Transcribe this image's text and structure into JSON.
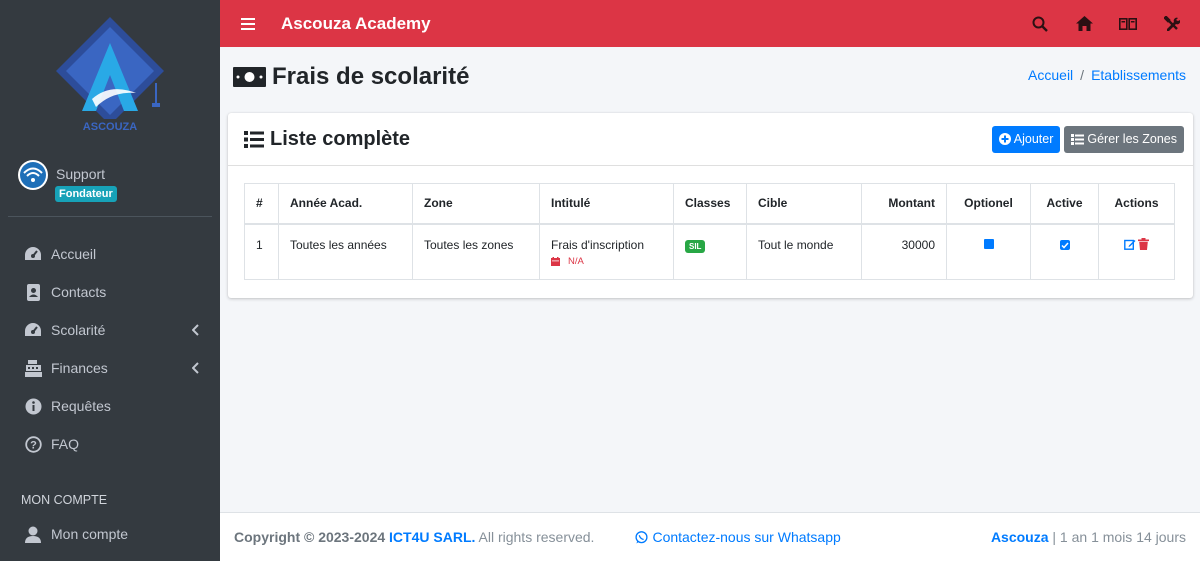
{
  "app": {
    "brand": "Ascouza Academy",
    "logo_text": "ASCOUZA"
  },
  "user": {
    "name": "Support",
    "role": "Fondateur"
  },
  "sidebar": {
    "items": [
      {
        "label": "Accueil",
        "icon": "dashboard-icon"
      },
      {
        "label": "Contacts",
        "icon": "address-book-icon"
      },
      {
        "label": "Scolarité",
        "icon": "dashboard-icon",
        "has_children": true
      },
      {
        "label": "Finances",
        "icon": "cash-register-icon",
        "has_children": true
      },
      {
        "label": "Requêtes",
        "icon": "info-circle-icon"
      },
      {
        "label": "FAQ",
        "icon": "question-circle-icon"
      }
    ],
    "section_header": "MON COMPTE",
    "account_item": {
      "label": "Mon compte",
      "icon": "user-icon"
    }
  },
  "page": {
    "title": "Frais de scolarité",
    "breadcrumb": [
      "Accueil",
      "Etablissements"
    ]
  },
  "card": {
    "title": "Liste complète",
    "add_button": "Ajouter",
    "zones_button": "Gérer les Zones"
  },
  "table": {
    "headers": [
      "#",
      "Année Acad.",
      "Zone",
      "Intitulé",
      "Classes",
      "Cible",
      "Montant",
      "Optionel",
      "Active",
      "Actions"
    ],
    "rows": [
      {
        "num": "1",
        "year": "Toutes les années",
        "zone": "Toutes les zones",
        "title": "Frais d'inscription",
        "date": "N/A",
        "classes": "SIL",
        "target": "Tout le monde",
        "amount": "30000",
        "optional": true,
        "active": true
      }
    ]
  },
  "footer": {
    "copyright_prefix": "Copyright © 2023-2024",
    "company": "ICT4U SARL.",
    "rights": " All rights reserved.",
    "whatsapp": "Contactez-nous sur Whatsapp",
    "brand": "Ascouza",
    "uptime": " | 1 an 1 mois 14 jours"
  },
  "colors": {
    "topbar": "#dc3545",
    "sidebar": "#343a40",
    "primary": "#007bff",
    "success": "#28a745",
    "info": "#17a2b8"
  }
}
